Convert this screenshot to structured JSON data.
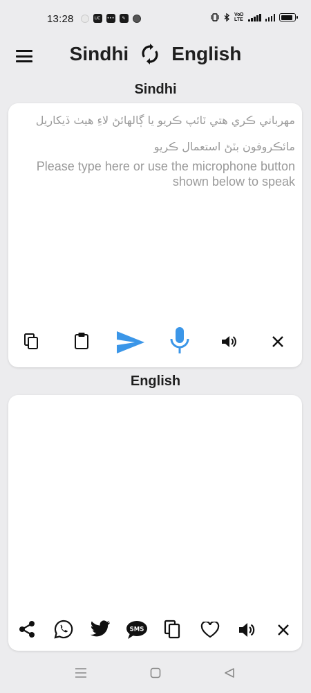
{
  "status_bar": {
    "time": "13:28",
    "left_icons": [
      "uc-browser-icon",
      "chat-icon",
      "app-icon",
      "settings-icon"
    ],
    "network_label": "VoD LTE",
    "battery_level": 0.85
  },
  "header": {
    "source_language": "Sindhi",
    "target_language": "English",
    "menu_icon": "hamburger-menu-icon",
    "swap_icon": "swap-languages-icon"
  },
  "input_section": {
    "label": "Sindhi",
    "placeholder_sindhi_line1": "مهرباني ڪري هتي ٽائپ ڪريو يا ڳالهائڻ لاءِ هيٺ ڏيکاريل",
    "placeholder_sindhi_line2": "مائڪروفون بٽڻ استعمال ڪريو",
    "placeholder_english": "Please type here or use the microphone button shown below to speak",
    "toolbar_icons": [
      "copy-icon",
      "paste-icon",
      "send-icon",
      "microphone-icon",
      "speaker-icon",
      "clear-icon"
    ],
    "accent_color": "#3b96e8"
  },
  "output_section": {
    "label": "English",
    "text": "",
    "toolbar_icons": [
      "share-icon",
      "whatsapp-icon",
      "twitter-icon",
      "sms-icon",
      "copy-icon",
      "favorite-icon",
      "speaker-icon",
      "clear-icon"
    ]
  },
  "nav_bar": {
    "icons": [
      "recent-apps-icon",
      "home-icon",
      "back-icon"
    ]
  }
}
